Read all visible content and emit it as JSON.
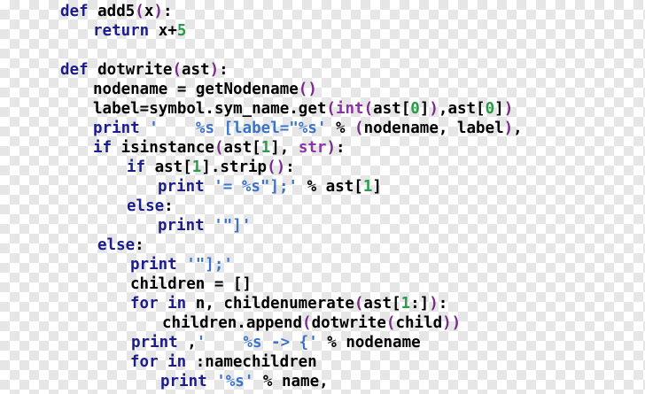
{
  "colors": {
    "keyword": "#1c1c8c",
    "identifier": "#000000",
    "number": "#2a9a4a",
    "string": "#3a73c9",
    "builtin": "#8e32a8",
    "paren": "#7a2a8a"
  },
  "code_lines": [
    {
      "indent": 0,
      "tokens": [
        {
          "t": "kw",
          "s": "def"
        },
        {
          "t": "id",
          "s": " add5"
        },
        {
          "t": "paren",
          "s": "("
        },
        {
          "t": "id",
          "s": "x"
        },
        {
          "t": "paren",
          "s": ")"
        },
        {
          "t": "id",
          "s": ":"
        }
      ]
    },
    {
      "indent": 1,
      "tokens": [
        {
          "t": "kw",
          "s": "return"
        },
        {
          "t": "id",
          "s": " x+"
        },
        {
          "t": "num",
          "s": "5"
        }
      ]
    },
    {
      "indent": 0,
      "tokens": []
    },
    {
      "indent": 0,
      "tokens": [
        {
          "t": "kw",
          "s": "def"
        },
        {
          "t": "id",
          "s": " dotwrite"
        },
        {
          "t": "paren",
          "s": "("
        },
        {
          "t": "id",
          "s": "ast"
        },
        {
          "t": "paren",
          "s": ")"
        },
        {
          "t": "id",
          "s": ":"
        }
      ]
    },
    {
      "indent": 1,
      "tokens": [
        {
          "t": "id",
          "s": "nodename = getNodename"
        },
        {
          "t": "paren",
          "s": "()"
        }
      ]
    },
    {
      "indent": 1,
      "tokens": [
        {
          "t": "id",
          "s": "label=symbol.sym_name.get"
        },
        {
          "t": "paren",
          "s": "("
        },
        {
          "t": "bi",
          "s": "int"
        },
        {
          "t": "paren",
          "s": "("
        },
        {
          "t": "id",
          "s": "ast["
        },
        {
          "t": "num",
          "s": "0"
        },
        {
          "t": "id",
          "s": "]"
        },
        {
          "t": "paren",
          "s": ")"
        },
        {
          "t": "id",
          "s": ",ast["
        },
        {
          "t": "num",
          "s": "0"
        },
        {
          "t": "id",
          "s": "]"
        },
        {
          "t": "paren",
          "s": ")"
        }
      ]
    },
    {
      "indent": 1,
      "tokens": [
        {
          "t": "kw",
          "s": "print"
        },
        {
          "t": "str",
          "s": " '    %s [label=\"%s' "
        },
        {
          "t": "id",
          "s": "% "
        },
        {
          "t": "paren",
          "s": "("
        },
        {
          "t": "id",
          "s": "nodename, label"
        },
        {
          "t": "paren",
          "s": ")"
        },
        {
          "t": "id",
          "s": ","
        }
      ]
    },
    {
      "indent": 1,
      "tokens": [
        {
          "t": "kw",
          "s": "if"
        },
        {
          "t": "id",
          "s": " isinstance"
        },
        {
          "t": "paren",
          "s": "("
        },
        {
          "t": "id",
          "s": "ast["
        },
        {
          "t": "num",
          "s": "1"
        },
        {
          "t": "id",
          "s": "], "
        },
        {
          "t": "bi",
          "s": "str"
        },
        {
          "t": "paren",
          "s": ")"
        },
        {
          "t": "id",
          "s": ":"
        }
      ]
    },
    {
      "indent": 2,
      "tokens": [
        {
          "t": "kw",
          "s": "if"
        },
        {
          "t": "id",
          "s": " ast["
        },
        {
          "t": "num",
          "s": "1"
        },
        {
          "t": "id",
          "s": "].strip"
        },
        {
          "t": "paren",
          "s": "()"
        },
        {
          "t": "id",
          "s": ":"
        }
      ]
    },
    {
      "indent": 3,
      "tokens": [
        {
          "t": "kw",
          "s": "print"
        },
        {
          "t": "str",
          "s": " '= %s\"];' "
        },
        {
          "t": "id",
          "s": "% ast["
        },
        {
          "t": "num",
          "s": "1"
        },
        {
          "t": "id",
          "s": "]"
        }
      ]
    },
    {
      "indent": 2,
      "tokens": [
        {
          "t": "kw",
          "s": "else"
        },
        {
          "t": "id",
          "s": ":"
        }
      ]
    },
    {
      "indent": 3,
      "tokens": [
        {
          "t": "kw",
          "s": "print"
        },
        {
          "t": "str",
          "s": " '\"]'"
        }
      ]
    },
    {
      "indent": 1,
      "tokens": [
        {
          "t": "kw",
          "s": "else"
        },
        {
          "t": "id",
          "s": ":"
        }
      ]
    },
    {
      "indent": 2,
      "tokens": [
        {
          "t": "kw",
          "s": "print"
        },
        {
          "t": "str",
          "s": " '\"];'"
        }
      ]
    },
    {
      "indent": 2,
      "tokens": [
        {
          "t": "id",
          "s": "children = []"
        }
      ]
    },
    {
      "indent": 2,
      "tokens": [
        {
          "t": "kw",
          "s": "for"
        },
        {
          "t": "kw",
          "s": " in"
        },
        {
          "t": "id",
          "s": " n, childenumerate"
        },
        {
          "t": "paren",
          "s": "("
        },
        {
          "t": "id",
          "s": "ast["
        },
        {
          "t": "num",
          "s": "1"
        },
        {
          "t": "id",
          "s": ":]"
        },
        {
          "t": "paren",
          "s": ")"
        },
        {
          "t": "id",
          "s": ":"
        }
      ]
    },
    {
      "indent": 3,
      "tokens": [
        {
          "t": "id",
          "s": "children.append"
        },
        {
          "t": "paren",
          "s": "("
        },
        {
          "t": "id",
          "s": "dotwrite"
        },
        {
          "t": "paren",
          "s": "("
        },
        {
          "t": "id",
          "s": "child"
        },
        {
          "t": "paren",
          "s": "))"
        }
      ]
    },
    {
      "indent": 2,
      "tokens": [
        {
          "t": "kw",
          "s": "print"
        },
        {
          "t": "id",
          "s": " ,"
        },
        {
          "t": "str",
          "s": "'    %s -> {' "
        },
        {
          "t": "id",
          "s": "% nodename"
        }
      ]
    },
    {
      "indent": 2,
      "tokens": [
        {
          "t": "kw",
          "s": "for"
        },
        {
          "t": "kw",
          "s": " in"
        },
        {
          "t": "id",
          "s": " :namechildren"
        }
      ]
    },
    {
      "indent": 3,
      "tokens": [
        {
          "t": "kw",
          "s": "print"
        },
        {
          "t": "str",
          "s": " '%s' "
        },
        {
          "t": "id",
          "s": "% name,"
        }
      ]
    }
  ]
}
